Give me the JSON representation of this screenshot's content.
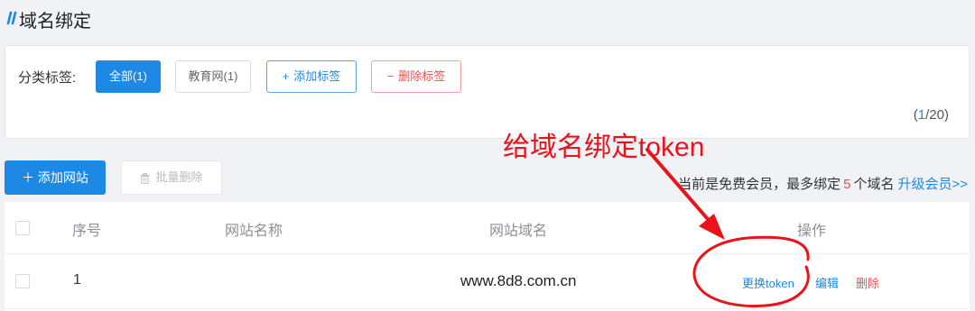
{
  "page": {
    "title": "域名绑定"
  },
  "filters": {
    "label": "分类标签:",
    "tags": [
      {
        "label": "全部(1)",
        "active": true
      },
      {
        "label": "教育网(1)",
        "active": false
      }
    ],
    "add_tag": {
      "symbol": "+",
      "label": "添加标签"
    },
    "delete_tag": {
      "symbol": "−",
      "label": "删除标签"
    },
    "count": {
      "open": "(",
      "current": "1",
      "sep_total": "/20)"
    }
  },
  "annotation": {
    "text": "给域名绑定token"
  },
  "toolbar": {
    "add_site": "＋ 添加网站",
    "batch_delete": "批量删除"
  },
  "membership": {
    "before": "当前是免费会员，最多绑定",
    "limit": "5",
    "after": "个域名",
    "upgrade": "升级会员>>"
  },
  "table": {
    "columns": {
      "no": "序号",
      "name": "网站名称",
      "domain": "网站域名",
      "ops": "操作"
    },
    "rows": [
      {
        "no": "1",
        "name": "",
        "domain": "www.8d8.com.cn",
        "ops": {
          "token": "更换token",
          "edit": "编辑",
          "delete": "删除"
        }
      }
    ]
  },
  "colors": {
    "primary": "#1e88e5",
    "danger": "#ef4f4f",
    "annotation": "#e8131b",
    "background": "#f0f2f5"
  }
}
